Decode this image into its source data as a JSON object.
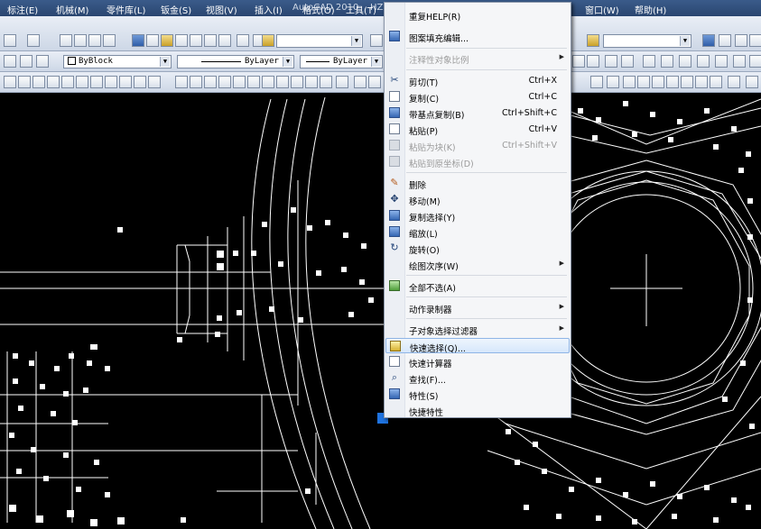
{
  "window": {
    "title": "AutoCAD 2010",
    "title_suffix": "HZ"
  },
  "menu": [
    {
      "label": "标注(E)"
    },
    {
      "label": "机械(M)"
    },
    {
      "label": "零件库(L)"
    },
    {
      "label": "钣金(S)"
    },
    {
      "label": "视图(V)"
    },
    {
      "label": "插入(I)"
    },
    {
      "label": "格式(O)"
    },
    {
      "label": "工具(T)"
    },
    {
      "label": "窗口(W)"
    },
    {
      "label": "帮助(H)"
    }
  ],
  "toolbar": {
    "color_combo": "ByBlock",
    "linetype_combo": "ByLayer",
    "lineweight_combo": "ByLayer"
  },
  "context_menu": {
    "items": [
      {
        "label": "重复HELP(R)",
        "shortcut": "",
        "disabled": false,
        "icon": "repeat-icon"
      },
      {
        "label": "图案填充编辑...",
        "shortcut": "",
        "disabled": false,
        "icon": "hatch-edit-icon"
      },
      {
        "label": "注释性对象比例",
        "shortcut": "",
        "disabled": true,
        "submenu": true,
        "icon": ""
      },
      {
        "label": "剪切(T)",
        "shortcut": "Ctrl+X",
        "disabled": false,
        "icon": "cut-icon"
      },
      {
        "label": "复制(C)",
        "shortcut": "Ctrl+C",
        "disabled": false,
        "icon": "copy-icon"
      },
      {
        "label": "带基点复制(B)",
        "shortcut": "Ctrl+Shift+C",
        "disabled": false,
        "icon": "copy-base-icon"
      },
      {
        "label": "粘贴(P)",
        "shortcut": "Ctrl+V",
        "disabled": false,
        "icon": "paste-icon"
      },
      {
        "label": "粘贴为块(K)",
        "shortcut": "Ctrl+Shift+V",
        "disabled": true,
        "icon": "paste-block-icon"
      },
      {
        "label": "粘贴到原坐标(D)",
        "shortcut": "",
        "disabled": true,
        "icon": "paste-orig-icon"
      },
      {
        "label": "删除",
        "shortcut": "",
        "disabled": false,
        "icon": "erase-icon"
      },
      {
        "label": "移动(M)",
        "shortcut": "",
        "disabled": false,
        "icon": "move-icon"
      },
      {
        "label": "复制选择(Y)",
        "shortcut": "",
        "disabled": false,
        "icon": "copy-select-icon"
      },
      {
        "label": "缩放(L)",
        "shortcut": "",
        "disabled": false,
        "icon": "scale-icon"
      },
      {
        "label": "旋转(O)",
        "shortcut": "",
        "disabled": false,
        "icon": "rotate-icon"
      },
      {
        "label": "绘图次序(W)",
        "shortcut": "",
        "disabled": false,
        "submenu": true,
        "icon": ""
      },
      {
        "label": "全部不选(A)",
        "shortcut": "",
        "disabled": false,
        "icon": "deselect-icon"
      },
      {
        "label": "动作录制器",
        "shortcut": "",
        "disabled": false,
        "submenu": true,
        "icon": ""
      },
      {
        "label": "子对象选择过滤器",
        "shortcut": "",
        "disabled": false,
        "submenu": true,
        "icon": ""
      },
      {
        "label": "快速选择(Q)...",
        "shortcut": "",
        "disabled": false,
        "highlighted": true,
        "icon": "quick-select-icon"
      },
      {
        "label": "快速计算器",
        "shortcut": "",
        "disabled": false,
        "icon": "calculator-icon"
      },
      {
        "label": "查找(F)...",
        "shortcut": "",
        "disabled": false,
        "icon": "find-icon"
      },
      {
        "label": "特性(S)",
        "shortcut": "",
        "disabled": false,
        "icon": "properties-icon"
      },
      {
        "label": "快捷特性",
        "shortcut": "",
        "disabled": false,
        "icon": ""
      }
    ]
  }
}
